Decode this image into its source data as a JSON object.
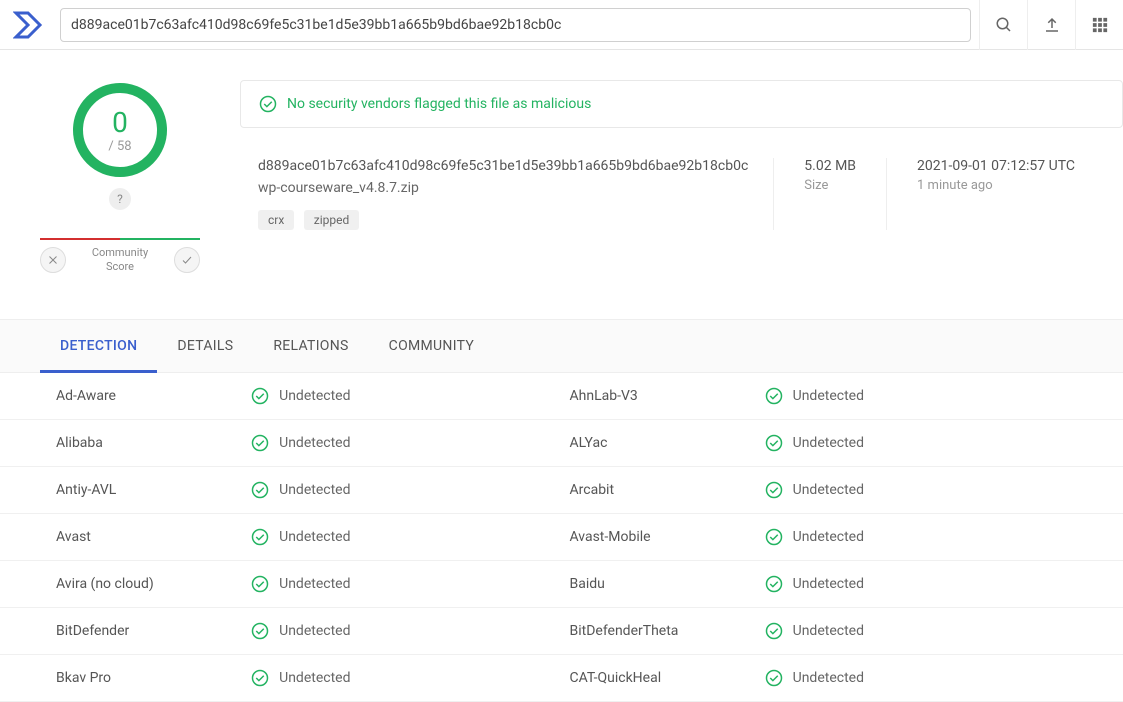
{
  "search": {
    "value": "d889ace01b7c63afc410d98c69fe5c31be1d5e39bb1a665b9bd6bae92b18cb0c"
  },
  "score": {
    "numerator": "0",
    "denominator": "/ 58"
  },
  "community": {
    "label": "Community\nScore",
    "tooltip": "?"
  },
  "banner": {
    "text": "No security vendors flagged this file as malicious"
  },
  "file": {
    "hash": "d889ace01b7c63afc410d98c69fe5c31be1d5e39bb1a665b9bd6bae92b18cb0c",
    "name": "wp-courseware_v4.8.7.zip",
    "tags": [
      "crx",
      "zipped"
    ]
  },
  "size": {
    "value": "5.02 MB",
    "label": "Size"
  },
  "time": {
    "value": "2021-09-01 07:12:57 UTC",
    "label": "1 minute ago"
  },
  "tabs": [
    "DETECTION",
    "DETAILS",
    "RELATIONS",
    "COMMUNITY"
  ],
  "detections": [
    {
      "vendor": "Ad-Aware",
      "result": "Undetected"
    },
    {
      "vendor": "AhnLab-V3",
      "result": "Undetected"
    },
    {
      "vendor": "Alibaba",
      "result": "Undetected"
    },
    {
      "vendor": "ALYac",
      "result": "Undetected"
    },
    {
      "vendor": "Antiy-AVL",
      "result": "Undetected"
    },
    {
      "vendor": "Arcabit",
      "result": "Undetected"
    },
    {
      "vendor": "Avast",
      "result": "Undetected"
    },
    {
      "vendor": "Avast-Mobile",
      "result": "Undetected"
    },
    {
      "vendor": "Avira (no cloud)",
      "result": "Undetected"
    },
    {
      "vendor": "Baidu",
      "result": "Undetected"
    },
    {
      "vendor": "BitDefender",
      "result": "Undetected"
    },
    {
      "vendor": "BitDefenderTheta",
      "result": "Undetected"
    },
    {
      "vendor": "Bkav Pro",
      "result": "Undetected"
    },
    {
      "vendor": "CAT-QuickHeal",
      "result": "Undetected"
    }
  ]
}
